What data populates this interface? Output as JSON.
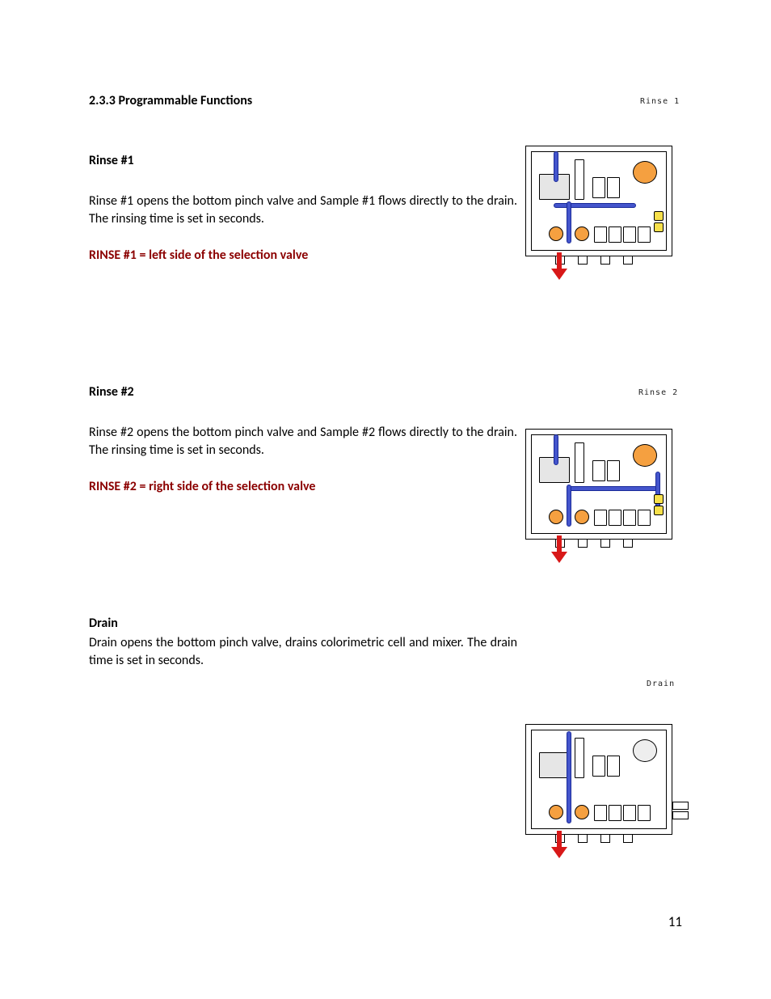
{
  "section": {
    "number_title": "2.3.3 Programmable Functions"
  },
  "rinse1": {
    "heading": "Rinse #1",
    "text": "Rinse #1 opens the bottom pinch valve and Sample #1 flows directly to the drain. The rinsing time is set in seconds.",
    "note": "RINSE #1 = left side of the selection valve",
    "figure_label": "Rinse 1"
  },
  "rinse2": {
    "heading": "Rinse #2",
    "text": "Rinse #2 opens the bottom pinch valve and Sample #2 flows directly to the drain. The rinsing time is set in seconds.",
    "note": "RINSE #2 = right side of the selection valve",
    "figure_label": "Rinse 2"
  },
  "drain": {
    "heading": "Drain",
    "text": "Drain opens the bottom pinch valve, drains colorimetric cell and mixer. The drain time is set in seconds.",
    "figure_label": "Drain"
  },
  "page_number": "11"
}
